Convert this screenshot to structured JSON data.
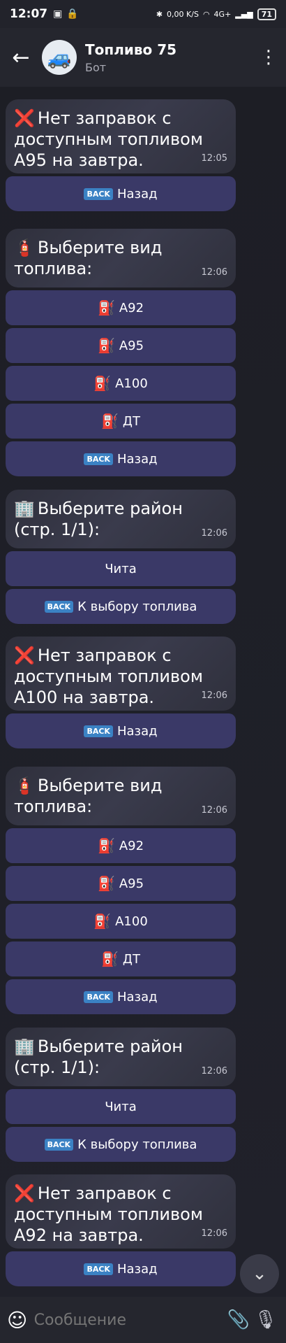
{
  "status": {
    "time": "12:07",
    "net_speed": "0,00 K/S",
    "network": "4G+",
    "battery": "71"
  },
  "header": {
    "back_icon": "arrow-left-icon",
    "title": "Топливо 75",
    "subtitle": "Бот",
    "more_icon": "more-vertical-icon"
  },
  "chat": {
    "groups": [
      {
        "text": "Нет заправок с доступным топливом А95 на завтра.",
        "emoji": "❌",
        "time": "12:05",
        "buttons": [
          "Назад"
        ]
      },
      {
        "text": "Выберите вид топлива:",
        "emoji": "🧯",
        "time": "12:06",
        "buttons": [
          "А92",
          "А95",
          "А100",
          "ДТ",
          "Назад"
        ]
      },
      {
        "text": "Выберите район (стр. 1/1):",
        "emoji": "🏢",
        "time": "12:06",
        "buttons": [
          "Чита",
          "К выбору топлива"
        ]
      },
      {
        "text": "Нет заправок с доступным топливом А100 на завтра.",
        "emoji": "❌",
        "time": "12:06",
        "buttons": [
          "Назад"
        ]
      },
      {
        "text": "Выберите вид топлива:",
        "emoji": "🧯",
        "time": "12:06",
        "buttons": [
          "А92",
          "А95",
          "А100",
          "ДТ",
          "Назад"
        ]
      },
      {
        "text": "Выберите район (стр. 1/1):",
        "emoji": "🏢",
        "time": "12:06",
        "buttons": [
          "Чита",
          "К выбору топлива"
        ]
      },
      {
        "text": "Нет заправок с доступным топливом А92 на завтра.",
        "emoji": "❌",
        "time": "12:06",
        "buttons": [
          "Назад"
        ]
      }
    ]
  },
  "input": {
    "placeholder": "Сообщение"
  }
}
